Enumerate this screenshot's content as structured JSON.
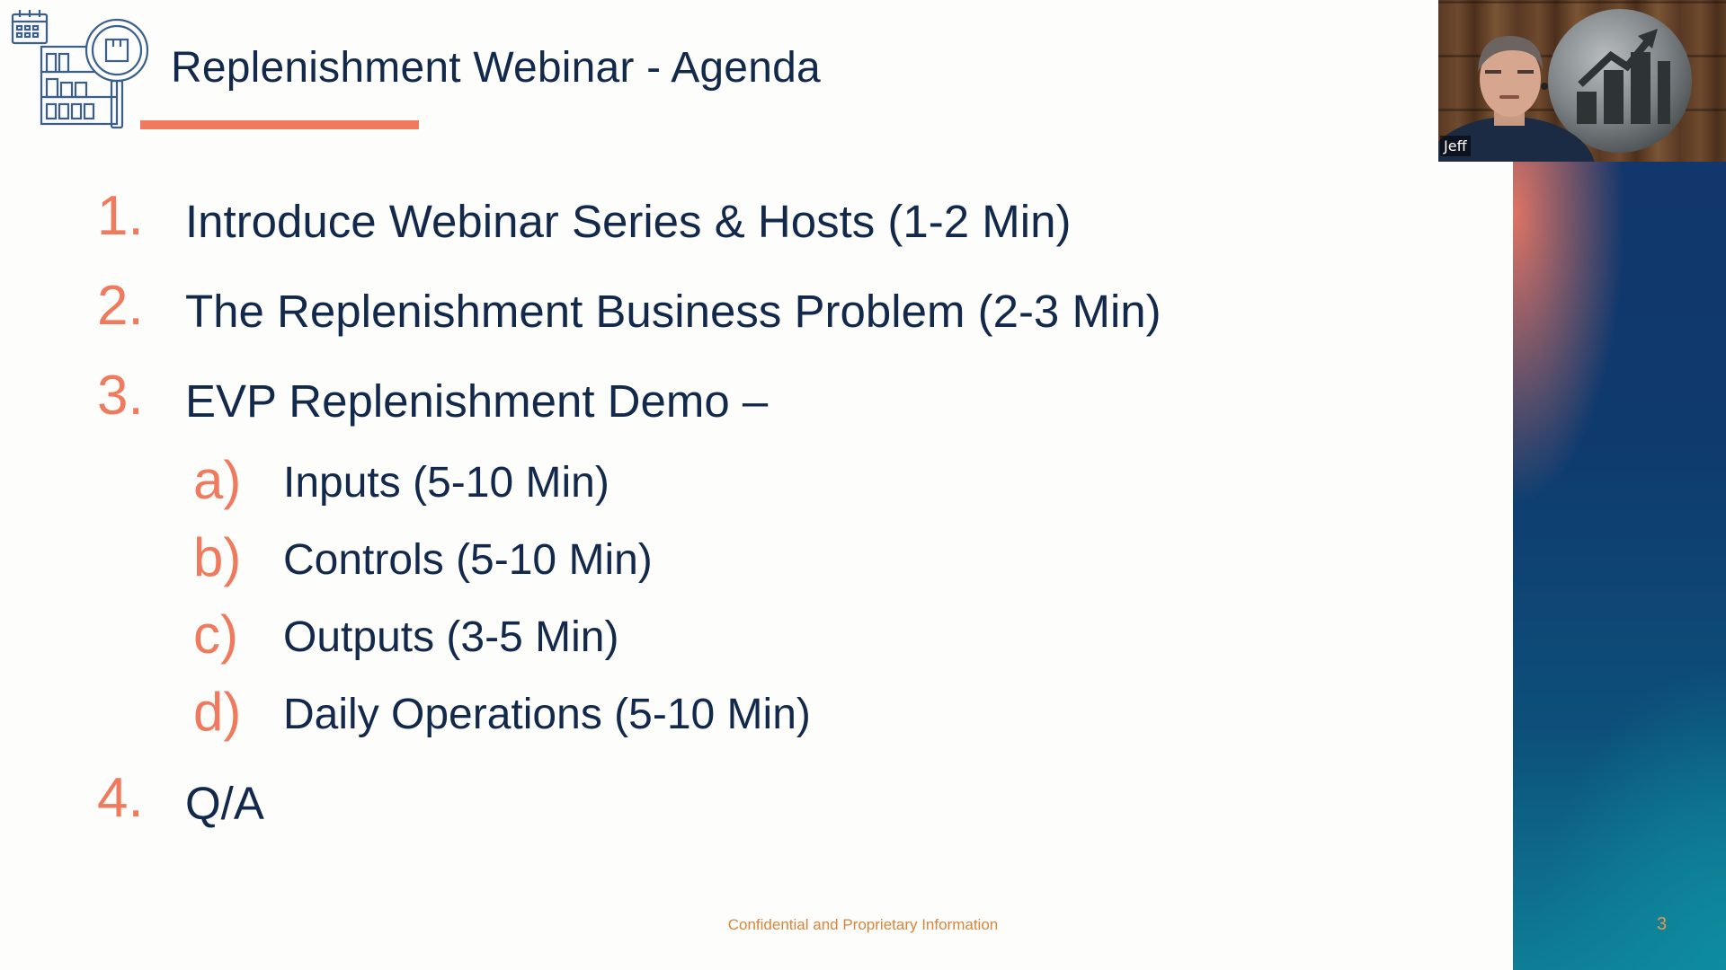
{
  "slide": {
    "title": "Replenishment Webinar - Agenda",
    "page_number": "3",
    "footer": "Confidential and Proprietary Information"
  },
  "agenda": {
    "items": [
      {
        "marker": "1.",
        "text": "Introduce Webinar Series & Hosts (1-2 Min)"
      },
      {
        "marker": "2.",
        "text": "The Replenishment Business Problem (2-3 Min)"
      },
      {
        "marker": "3.",
        "text": "EVP Replenishment Demo –"
      },
      {
        "marker": "4.",
        "text": "Q/A"
      }
    ],
    "subitems": [
      {
        "marker": "a)",
        "text": "Inputs (5-10 Min)"
      },
      {
        "marker": "b)",
        "text": "Controls (5-10 Min)"
      },
      {
        "marker": "c)",
        "text": "Outputs (3-5 Min)"
      },
      {
        "marker": "d)",
        "text": "Daily Operations (5-10 Min)"
      }
    ]
  },
  "webcam": {
    "participant_name": "Jeff"
  },
  "icons": {
    "header": "warehouse-inspection-icon",
    "webcam_logo": "bar-chart-arrow-logo"
  },
  "colors": {
    "accent": "#ef7a5e",
    "text": "#13294b",
    "footer_text": "#d9853a",
    "panel_top": "#13356a",
    "panel_bottom": "#0e7e96"
  }
}
